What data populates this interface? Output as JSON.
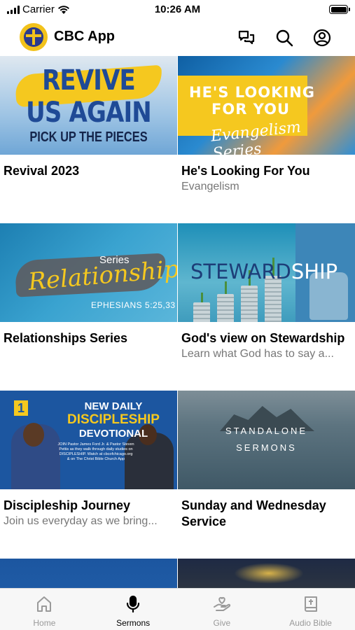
{
  "status_bar": {
    "carrier": "Carrier",
    "time": "10:26 AM"
  },
  "header": {
    "title": "CBC App"
  },
  "cards": [
    {
      "title": "Revival 2023",
      "subtitle": "",
      "thumb": {
        "line1": "REVIVE",
        "line2": "US AGAIN",
        "line3": "PICK UP THE PIECES"
      }
    },
    {
      "title": "He's Looking For You",
      "subtitle": "Evangelism",
      "thumb": {
        "line1": "HE'S LOOKING",
        "line2": "FOR YOU",
        "script": "Evangelism Series"
      }
    },
    {
      "title": "Relationships Series",
      "subtitle": "",
      "thumb": {
        "series": "Series",
        "script": "Relationships",
        "verse": "EPHESIANS 5:25,33"
      }
    },
    {
      "title": "God's view on Stewardship",
      "subtitle": "Learn what God has to say a...",
      "thumb": {
        "word_a": "STEWARD",
        "word_b": "SHIP"
      }
    },
    {
      "title": "Discipleship Journey",
      "subtitle": "Join us everyday as we bring...",
      "thumb": {
        "line1": "NEW DAILY",
        "line2": "DISCIPLESHIP",
        "line3": "DEVOTIONAL",
        "small": "JOIN Pastor James Ford Jr. & Pastor Steven Pettis as they walk through daily studies on DISCIPLESHIP. Watch at cbcofchicago.org & on The Christ Bible Church App",
        "badge": "1"
      }
    },
    {
      "title": "Sunday and Wednesday Service",
      "subtitle": "",
      "thumb": {
        "line1": "STANDALONE",
        "line2": "SERMONS"
      }
    }
  ],
  "tabs": [
    {
      "label": "Home",
      "icon": "home-icon",
      "active": false
    },
    {
      "label": "Sermons",
      "icon": "microphone-icon",
      "active": true
    },
    {
      "label": "Give",
      "icon": "give-heart-hand-icon",
      "active": false
    },
    {
      "label": "Audio Bible",
      "icon": "bible-icon",
      "active": false
    }
  ],
  "colors": {
    "accent_yellow": "#f5c81f",
    "brand_blue": "#2b3b8c",
    "inactive_tab": "#9a9a9a"
  }
}
